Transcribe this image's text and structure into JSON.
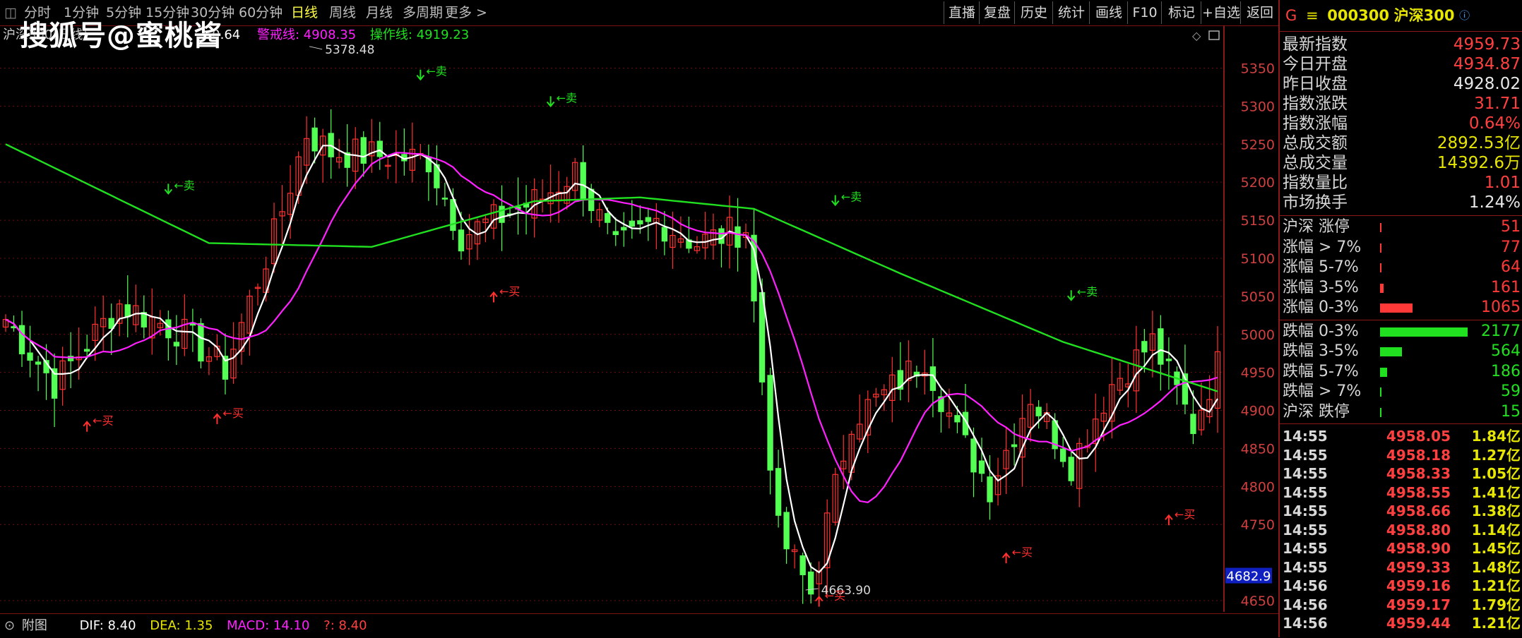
{
  "toolbar": {
    "periods": [
      "分时",
      "1分钟",
      "5分钟",
      "15分钟",
      "30分钟",
      "60分钟",
      "日线",
      "周线",
      "月线",
      "多周期",
      "更多 >"
    ],
    "active_period": "日线",
    "buttons": [
      "直播",
      "复盘",
      "历史",
      "统计",
      "画线",
      "F10",
      "标记",
      "+自选",
      "返回"
    ]
  },
  "watermark": "搜狐号@蜜桃酱",
  "legend": {
    "left_text": "沪深300(日线)",
    "ma_short_value": "0.64",
    "warning_label": "警戒线: 4908.35",
    "operation_label": "操作线: 4919.23"
  },
  "chart_data": {
    "type": "candlestick",
    "ylim": [
      4620,
      5390
    ],
    "y_ticks": [
      "5350",
      "5300",
      "5250",
      "5200",
      "5150",
      "5100",
      "5050",
      "5000",
      "4950",
      "4900",
      "4850",
      "4800",
      "4750",
      "4650"
    ],
    "current_price_tag": "4682.9",
    "high_annotation": "5378.48",
    "low_annotation": "4663.90",
    "signal_labels": {
      "buy": "买",
      "sell": "卖"
    },
    "buy_signals": [
      [
        10,
        4885
      ],
      [
        26,
        4895
      ],
      [
        60,
        5055
      ],
      [
        100,
        4655
      ],
      [
        123,
        4712
      ],
      [
        143,
        4762
      ]
    ],
    "sell_signals": [
      [
        20,
        5185
      ],
      [
        51,
        5335
      ],
      [
        67,
        5300
      ],
      [
        102,
        5170
      ],
      [
        131,
        5045
      ]
    ],
    "colors": {
      "up": "#ff3030",
      "down": "#54ff54",
      "ma_white": "#ffffff",
      "ma_magenta": "#ff20ff",
      "ma_green": "#20e020"
    }
  },
  "bottom": {
    "indicator_label": "附图",
    "dif": "DIF: 8.40",
    "dea": "DEA: 1.35",
    "macd": "MACD: 14.10",
    "extra": "?: 8.40"
  },
  "panel": {
    "title_prefix": "G",
    "code": "000300",
    "name": "沪深300",
    "stats": [
      {
        "label": "最新指数",
        "value": "4959.73",
        "color": "#ff4040"
      },
      {
        "label": "今日开盘",
        "value": "4934.87",
        "color": "#ff4040"
      },
      {
        "label": "昨日收盘",
        "value": "4928.02",
        "color": "#e8e8e8"
      },
      {
        "label": "指数涨跌",
        "value": "31.71",
        "color": "#ff4040"
      },
      {
        "label": "指数涨幅",
        "value": "0.64%",
        "color": "#ff4040"
      },
      {
        "label": "总成交额",
        "value": "2892.53亿",
        "color": "#e6e600"
      },
      {
        "label": "总成交量",
        "value": "14392.6万",
        "color": "#e6e600"
      },
      {
        "label": "指数量比",
        "value": "1.01",
        "color": "#ff4040"
      },
      {
        "label": "市场换手",
        "value": "1.24%",
        "color": "#e8e8e8"
      }
    ],
    "rise": [
      {
        "label": "沪深 涨停",
        "value": "51",
        "fraction": 0.01
      },
      {
        "label": "涨幅 > 7%",
        "value": "77",
        "fraction": 0.015
      },
      {
        "label": "涨幅 5-7%",
        "value": "64",
        "fraction": 0.013
      },
      {
        "label": "涨幅 3-5%",
        "value": "161",
        "fraction": 0.04
      },
      {
        "label": "涨幅 0-3%",
        "value": "1065",
        "fraction": 0.37
      }
    ],
    "fall": [
      {
        "label": "跌幅 0-3%",
        "value": "2177",
        "fraction": 1.0
      },
      {
        "label": "跌幅 3-5%",
        "value": "564",
        "fraction": 0.25
      },
      {
        "label": "跌幅 5-7%",
        "value": "186",
        "fraction": 0.08
      },
      {
        "label": "跌幅 > 7%",
        "value": "59",
        "fraction": 0.015
      },
      {
        "label": "沪深 跌停",
        "value": "15",
        "fraction": 0.008
      }
    ],
    "ticks": [
      {
        "time": "14:55",
        "price": "4958.05",
        "vol": "1.84亿"
      },
      {
        "time": "14:55",
        "price": "4958.18",
        "vol": "1.27亿"
      },
      {
        "time": "14:55",
        "price": "4958.33",
        "vol": "1.05亿"
      },
      {
        "time": "14:55",
        "price": "4958.55",
        "vol": "1.41亿"
      },
      {
        "time": "14:55",
        "price": "4958.66",
        "vol": "1.38亿"
      },
      {
        "time": "14:55",
        "price": "4958.80",
        "vol": "1.14亿"
      },
      {
        "time": "14:55",
        "price": "4958.90",
        "vol": "1.45亿"
      },
      {
        "time": "14:55",
        "price": "4959.33",
        "vol": "1.48亿"
      },
      {
        "time": "14:56",
        "price": "4959.16",
        "vol": "1.21亿"
      },
      {
        "time": "14:56",
        "price": "4959.17",
        "vol": "1.79亿"
      },
      {
        "time": "14:56",
        "price": "4959.44",
        "vol": "1.21亿"
      }
    ]
  }
}
